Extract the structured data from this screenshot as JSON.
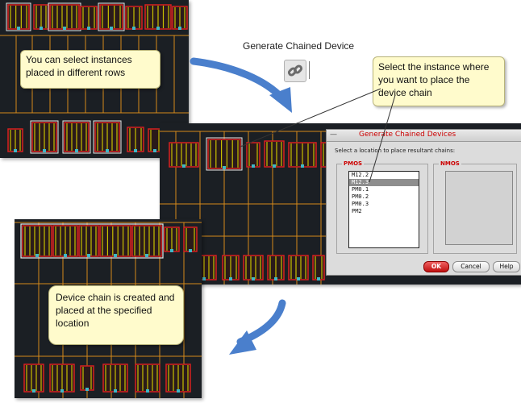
{
  "toolbar": {
    "generate_label": "Generate Chained Device",
    "generate_icon": "chain-link-icon"
  },
  "callouts": {
    "select_rows": "You can select instances placed in different rows",
    "select_instance": "Select the instance where you want to place the device chain",
    "chain_created": "Device chain is created and placed at the specified location"
  },
  "dialog": {
    "title": "Generate Chained Devices",
    "instruction": "Select a location to place resultant chains:",
    "pmos_label": "PMOS",
    "nmos_label": "NMOS",
    "pmos_items": [
      "M12.2",
      "M12.3",
      "PM0.1",
      "PM0.2",
      "PM0.3",
      "PM2"
    ],
    "pmos_selected": "M12.3",
    "nmos_items": [],
    "ok_label": "OK",
    "cancel_label": "Cancel",
    "help_label": "Help"
  },
  "colors": {
    "layout_bg": "#1b1f24",
    "callout_bg": "#fffbcc",
    "arrow_blue": "#4a7fcc",
    "title_red": "#cc0000",
    "device_red": "#d62020",
    "wire_orange": "#d68a1a",
    "wire_yellow": "#c8c000",
    "selection_white": "#ffffff"
  }
}
